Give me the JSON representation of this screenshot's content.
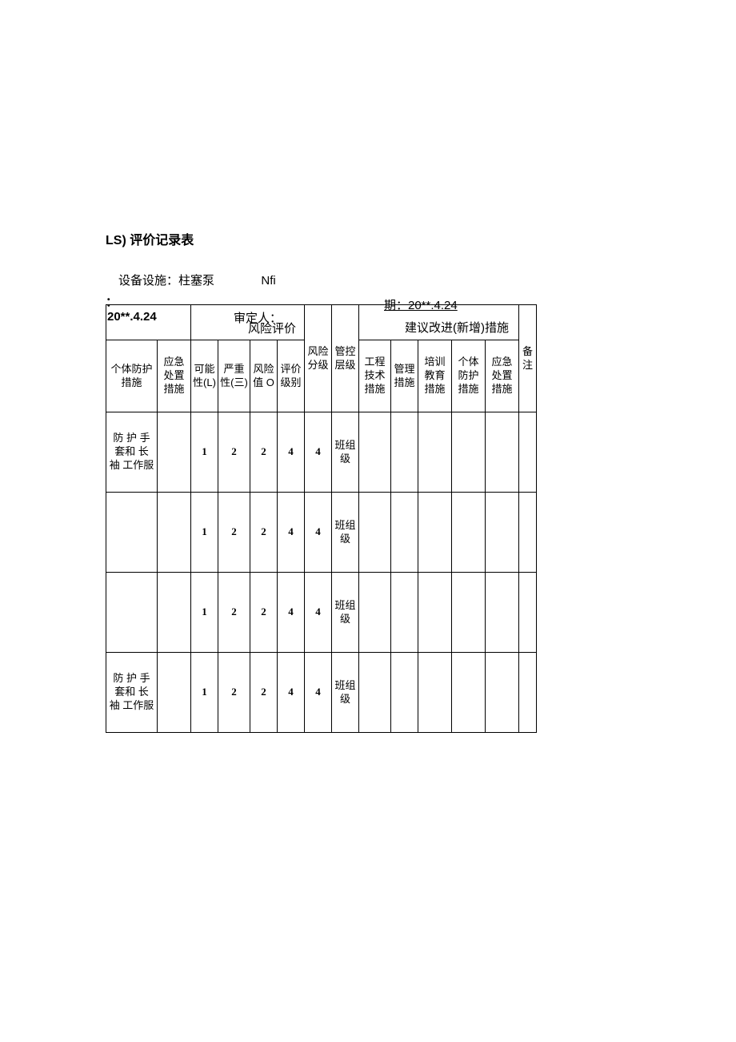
{
  "title": "LS) 评价记录表",
  "meta": {
    "equipment_label": "设备设施：柱塞泵",
    "nfi": "Nfi",
    "period_label": "期：20**.4.24",
    "colon": "：",
    "date_left": "20**.4.24",
    "reviewer_label": "审定人：",
    "risk_eval_label": "风险评价",
    "suggest_label": "建议改进(新增)措施"
  },
  "headers": {
    "col1": "个体防护措施",
    "col2": "应急处置措施",
    "col3": "可能性(L)",
    "col4": "严重性(三)",
    "col5": "风险值 O",
    "col6": "评价级别",
    "col7": "风险分级",
    "col8": "管控层级",
    "col9": "工程技术措施",
    "col10": "管理措施",
    "col11": "培训教育措施",
    "col12": "个体防护措施",
    "col13": "应急处置措施",
    "col14": "备注"
  },
  "rows": [
    {
      "ppe": "防 护 手 套和 长 袖 工作服",
      "emerg": "",
      "L": "1",
      "S": "2",
      "O": "2",
      "grade": "4",
      "risk": "4",
      "ctrl": "班组级",
      "c9": "",
      "c10": "",
      "c11": "",
      "c12": "",
      "c13": "",
      "note": ""
    },
    {
      "ppe": "",
      "emerg": "",
      "L": "1",
      "S": "2",
      "O": "2",
      "grade": "4",
      "risk": "4",
      "ctrl": "班组级",
      "c9": "",
      "c10": "",
      "c11": "",
      "c12": "",
      "c13": "",
      "note": ""
    },
    {
      "ppe": "",
      "emerg": "",
      "L": "1",
      "S": "2",
      "O": "2",
      "grade": "4",
      "risk": "4",
      "ctrl": "班组级",
      "c9": "",
      "c10": "",
      "c11": "",
      "c12": "",
      "c13": "",
      "note": ""
    },
    {
      "ppe": "防 护 手 套和 长 袖 工作服",
      "emerg": "",
      "L": "1",
      "S": "2",
      "O": "2",
      "grade": "4",
      "risk": "4",
      "ctrl": "班组级",
      "c9": "",
      "c10": "",
      "c11": "",
      "c12": "",
      "c13": "",
      "note": ""
    }
  ],
  "chart_data": {
    "type": "table",
    "title": "LS) 评价记录表",
    "columns": [
      "个体防护措施",
      "应急处置措施",
      "可能性(L)",
      "严重性(三)",
      "风险值 O",
      "评价级别",
      "风险分级",
      "管控层级",
      "工程技术措施",
      "管理措施",
      "培训教育措施",
      "个体防护措施",
      "应急处置措施",
      "备注"
    ],
    "rows": [
      [
        "防护手套和长袖工作服",
        "",
        1,
        2,
        2,
        4,
        4,
        "班组级",
        "",
        "",
        "",
        "",
        "",
        ""
      ],
      [
        "",
        "",
        1,
        2,
        2,
        4,
        4,
        "班组级",
        "",
        "",
        "",
        "",
        "",
        ""
      ],
      [
        "",
        "",
        1,
        2,
        2,
        4,
        4,
        "班组级",
        "",
        "",
        "",
        "",
        "",
        ""
      ],
      [
        "防护手套和长袖工作服",
        "",
        1,
        2,
        2,
        4,
        4,
        "班组级",
        "",
        "",
        "",
        "",
        "",
        ""
      ]
    ]
  }
}
